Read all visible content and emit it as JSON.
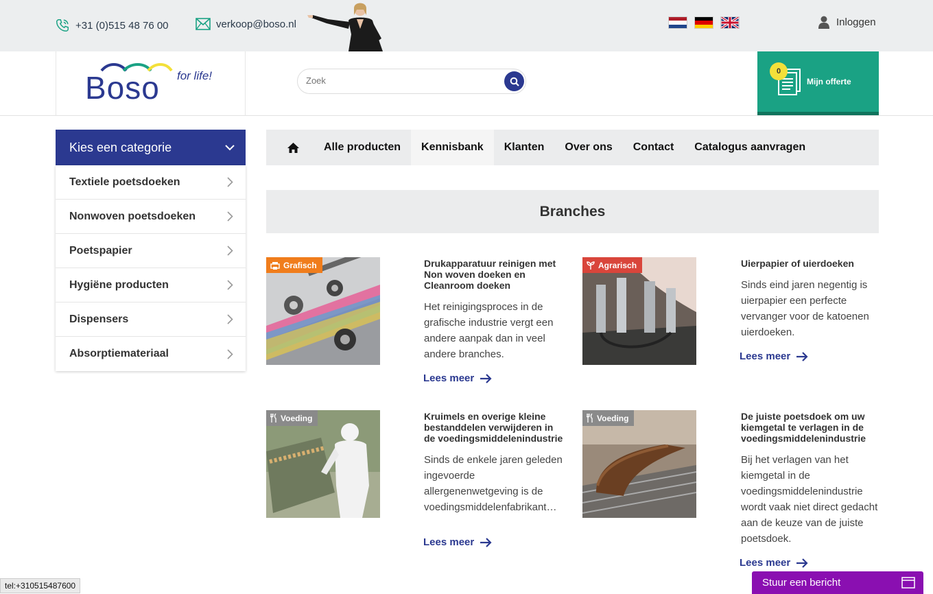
{
  "topbar": {
    "phone": "+31 (0)515 48 76 00",
    "email": "verkoop@boso.nl",
    "login": "Inloggen"
  },
  "header": {
    "logo_word": "Boso",
    "logo_tag": "for life!",
    "search_placeholder": "Zoek",
    "offerte_count": "0",
    "offerte_label": "Mijn offerte"
  },
  "sidebar": {
    "title": "Kies een categorie",
    "items": [
      "Textiele poetsdoeken",
      "Nonwoven poetsdoeken",
      "Poetspapier",
      "Hygiëne producten",
      "Dispensers",
      "Absorptiemateriaal"
    ]
  },
  "nav": {
    "items": [
      "Alle producten",
      "Kennisbank",
      "Klanten",
      "Over ons",
      "Contact",
      "Catalogus aanvragen"
    ]
  },
  "section_title": "Branches",
  "cards": [
    {
      "tag": "Grafisch",
      "tag_color": "#f07d1c",
      "title": "Drukapparatuur reinigen met Non woven doeken en Cleanroom doeken",
      "body": "Het reinigingsproces in de grafische industrie vergt een andere aanpak dan in veel andere branches.",
      "link": "Lees meer"
    },
    {
      "tag": "Agrarisch",
      "tag_color": "#d9453b",
      "title": "Uierpapier of uierdoeken",
      "body": "Sinds eind jaren negentig is uierpapier een perfecte vervanger voor de katoenen uierdoeken.",
      "link": "Lees meer"
    },
    {
      "tag": "Voeding",
      "tag_color": "#8a8a8a",
      "title": "Kruimels en overige kleine bestanddelen verwijderen in de voedingsmiddelenindustrie",
      "body": "Sinds de enkele jaren geleden ingevoerde allergenenwetgeving is de voedingsmiddelenfabrikant…",
      "link": "Lees meer"
    },
    {
      "tag": "Voeding",
      "tag_color": "#8a8a8a",
      "title": "De juiste poetsdoek om uw kiemgetal te verlagen in de voedingsmiddelenindustrie",
      "body": "Bij het verlagen van het kiemgetal in de voedingsmiddelenindustrie wordt vaak niet direct gedacht aan de keuze van de juiste poetsdoek.",
      "link": "Lees meer"
    }
  ],
  "status_bar": "tel:+310515487600",
  "chat_label": "Stuur een bericht",
  "colors": {
    "brand_blue": "#2b3990",
    "offerte_green": "#1aa284",
    "chat_purple": "#8a0fb1",
    "badge_yellow": "#f3e03a"
  }
}
